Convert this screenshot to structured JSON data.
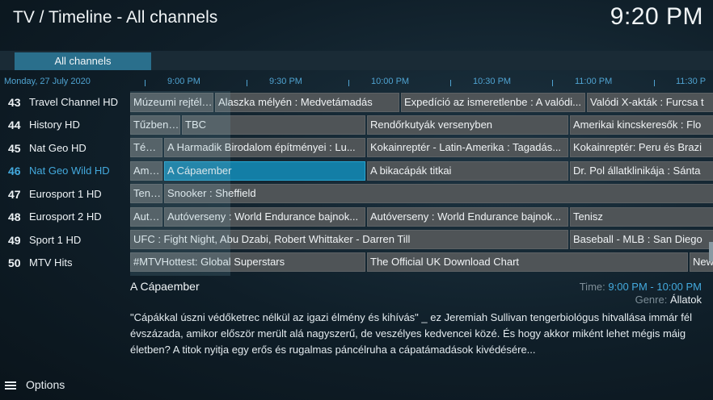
{
  "header": {
    "title": "TV / Timeline - All channels",
    "clock": "9:20 PM"
  },
  "tabs": [
    {
      "label": "All channels",
      "active": true
    }
  ],
  "timeline": {
    "date": "Monday, 27 July 2020",
    "times": [
      "9:00 PM",
      "9:30 PM",
      "10:00 PM",
      "10:30 PM",
      "11:00 PM",
      "11:30 P"
    ]
  },
  "channels": [
    {
      "number": "43",
      "name": "Travel Channel HD",
      "selected": false
    },
    {
      "number": "44",
      "name": "History HD",
      "selected": false
    },
    {
      "number": "45",
      "name": "Nat Geo HD",
      "selected": false
    },
    {
      "number": "46",
      "name": "Nat Geo Wild HD",
      "selected": true
    },
    {
      "number": "47",
      "name": "Eurosport 1 HD",
      "selected": false
    },
    {
      "number": "48",
      "name": "Eurosport 2 HD",
      "selected": false
    },
    {
      "number": "49",
      "name": "Sport 1 HD",
      "selected": false
    },
    {
      "number": "50",
      "name": "MTV Hits",
      "selected": false
    }
  ],
  "programs": [
    [
      {
        "title": "Múzeumi rejtélyek"
      },
      {
        "title": "Alaszka mélyén : Medvetámadás"
      },
      {
        "title": "Expedíció az ismeretlenbe : A valódi..."
      },
      {
        "title": "Valódi X-akták : Furcsa t"
      }
    ],
    [
      {
        "title": "Tűzben edzett"
      },
      {
        "title": "TBC"
      },
      {
        "title": "Rendőrkutyák versenyben"
      },
      {
        "title": "Amerikai kincskeresők : Flo"
      }
    ],
    [
      {
        "title": "Tények"
      },
      {
        "title": "A Harmadik Birodalom építményei : Lu..."
      },
      {
        "title": "Kokainreptér - Latin-Amerika : Tagadás..."
      },
      {
        "title": "Kokainreptér: Peru és Brazi"
      }
    ],
    [
      {
        "title": "Amerikai"
      },
      {
        "title": "A Cápaember"
      },
      {
        "title": "A bikacápák titkai"
      },
      {
        "title": "Dr. Pol állatklinikája : Sánta"
      }
    ],
    [
      {
        "title": "Tenisz"
      },
      {
        "title": "Snooker : Sheffield"
      }
    ],
    [
      {
        "title": "Autóverseny"
      },
      {
        "title": "Autóverseny : World Endurance bajnok..."
      },
      {
        "title": "Autóverseny : World Endurance bajnok..."
      },
      {
        "title": "Tenisz"
      }
    ],
    [
      {
        "title": "UFC : Fight Night, Abu Dzabi, Robert Whittaker - Darren Till"
      },
      {
        "title": "Baseball - MLB : San Diego"
      }
    ],
    [
      {
        "title": "#MTVHottest: Global Superstars"
      },
      {
        "title": "The Official UK Download Chart"
      },
      {
        "title": "New"
      }
    ]
  ],
  "details": {
    "title": "A Cápaember",
    "time_label": "Time:",
    "time_value": "9:00 PM - 10:00 PM",
    "genre_label": "Genre:",
    "genre_value": "Állatok",
    "description": "\"Cápákkal úszni védőketrec nélkül az igazi élmény és kihívás\" _ ez Jeremiah Sullivan tengerbiológus hitvallása immár fél évszázada, amikor először merült alá nagyszerű, de veszélyes kedvencei közé. És hogy akkor miként lehet mégis máig életben? A titok nyitja egy erős és rugalmas páncélruha a cápatámadások kivédésére..."
  },
  "footer": {
    "options_label": "Options"
  },
  "colors": {
    "accent": "#43a9dd",
    "focus": "#137ea6",
    "program_bg": "#4f5457"
  }
}
